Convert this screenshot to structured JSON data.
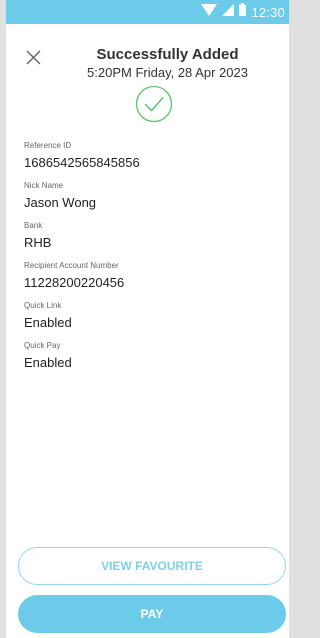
{
  "status_bar": {
    "time": "12:30",
    "icons": [
      "wifi-icon",
      "signal-icon",
      "battery-icon"
    ],
    "color": "#6ccbe8"
  },
  "header": {
    "title": "Successfully Added",
    "subtitle": "5:20PM Friday, 28 Apr 2023",
    "close_icon": "close-icon"
  },
  "success_icon": "check-circle-icon",
  "fields": [
    {
      "label": "Reference ID",
      "value": "1686542565845856"
    },
    {
      "label": "Nick Name",
      "value": "Jason Wong"
    },
    {
      "label": "Bank",
      "value": "RHB"
    },
    {
      "label": "Recipient Account Number",
      "value": "11228200220456"
    },
    {
      "label": "Quick Link",
      "value": "Enabled"
    },
    {
      "label": "Quick Pay",
      "value": "Enabled"
    }
  ],
  "buttons": {
    "view_favourite": "VIEW FAVOURITE",
    "pay": "PAY"
  },
  "colors": {
    "accent": "#6ccbe8",
    "success": "#5cc46a"
  }
}
